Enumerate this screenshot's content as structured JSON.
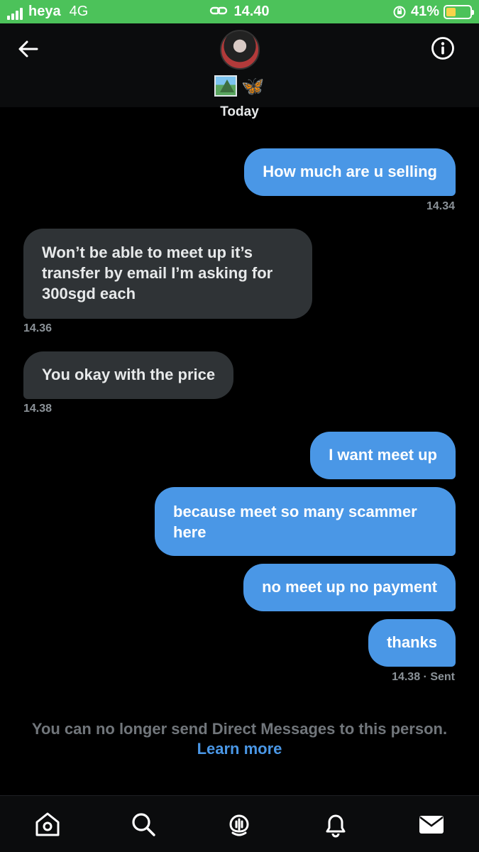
{
  "status_bar": {
    "carrier": "heya",
    "network": "4G",
    "time": "14.40",
    "battery": "41%",
    "battery_level": 0.41
  },
  "header": {
    "emoji_butterfly": "🦋",
    "date_label": "Today"
  },
  "messages": [
    {
      "side": "out",
      "text": "How much are u selling",
      "time": "14.34"
    },
    {
      "side": "in",
      "text": "Won’t be able to meet up it’s transfer by email I’m asking for 300sgd each",
      "time": "14.36"
    },
    {
      "side": "in",
      "text": "You okay with the price",
      "time": "14.38"
    },
    {
      "side": "out",
      "text": "I want meet up"
    },
    {
      "side": "out",
      "text": "because meet so many scammer here"
    },
    {
      "side": "out",
      "text": "no meet up no payment"
    },
    {
      "side": "out",
      "text": "thanks",
      "time": "14.38 · Sent"
    }
  ],
  "footer": {
    "notice": "You can no longer send Direct Messages to this person.",
    "link": "Learn more"
  },
  "tabs": [
    "home-icon",
    "search-icon",
    "spaces-icon",
    "bell-icon",
    "mail-icon"
  ],
  "colors": {
    "accent": "#4a97e6",
    "incoming": "#2f3336",
    "status_bar": "#4cc25a"
  }
}
